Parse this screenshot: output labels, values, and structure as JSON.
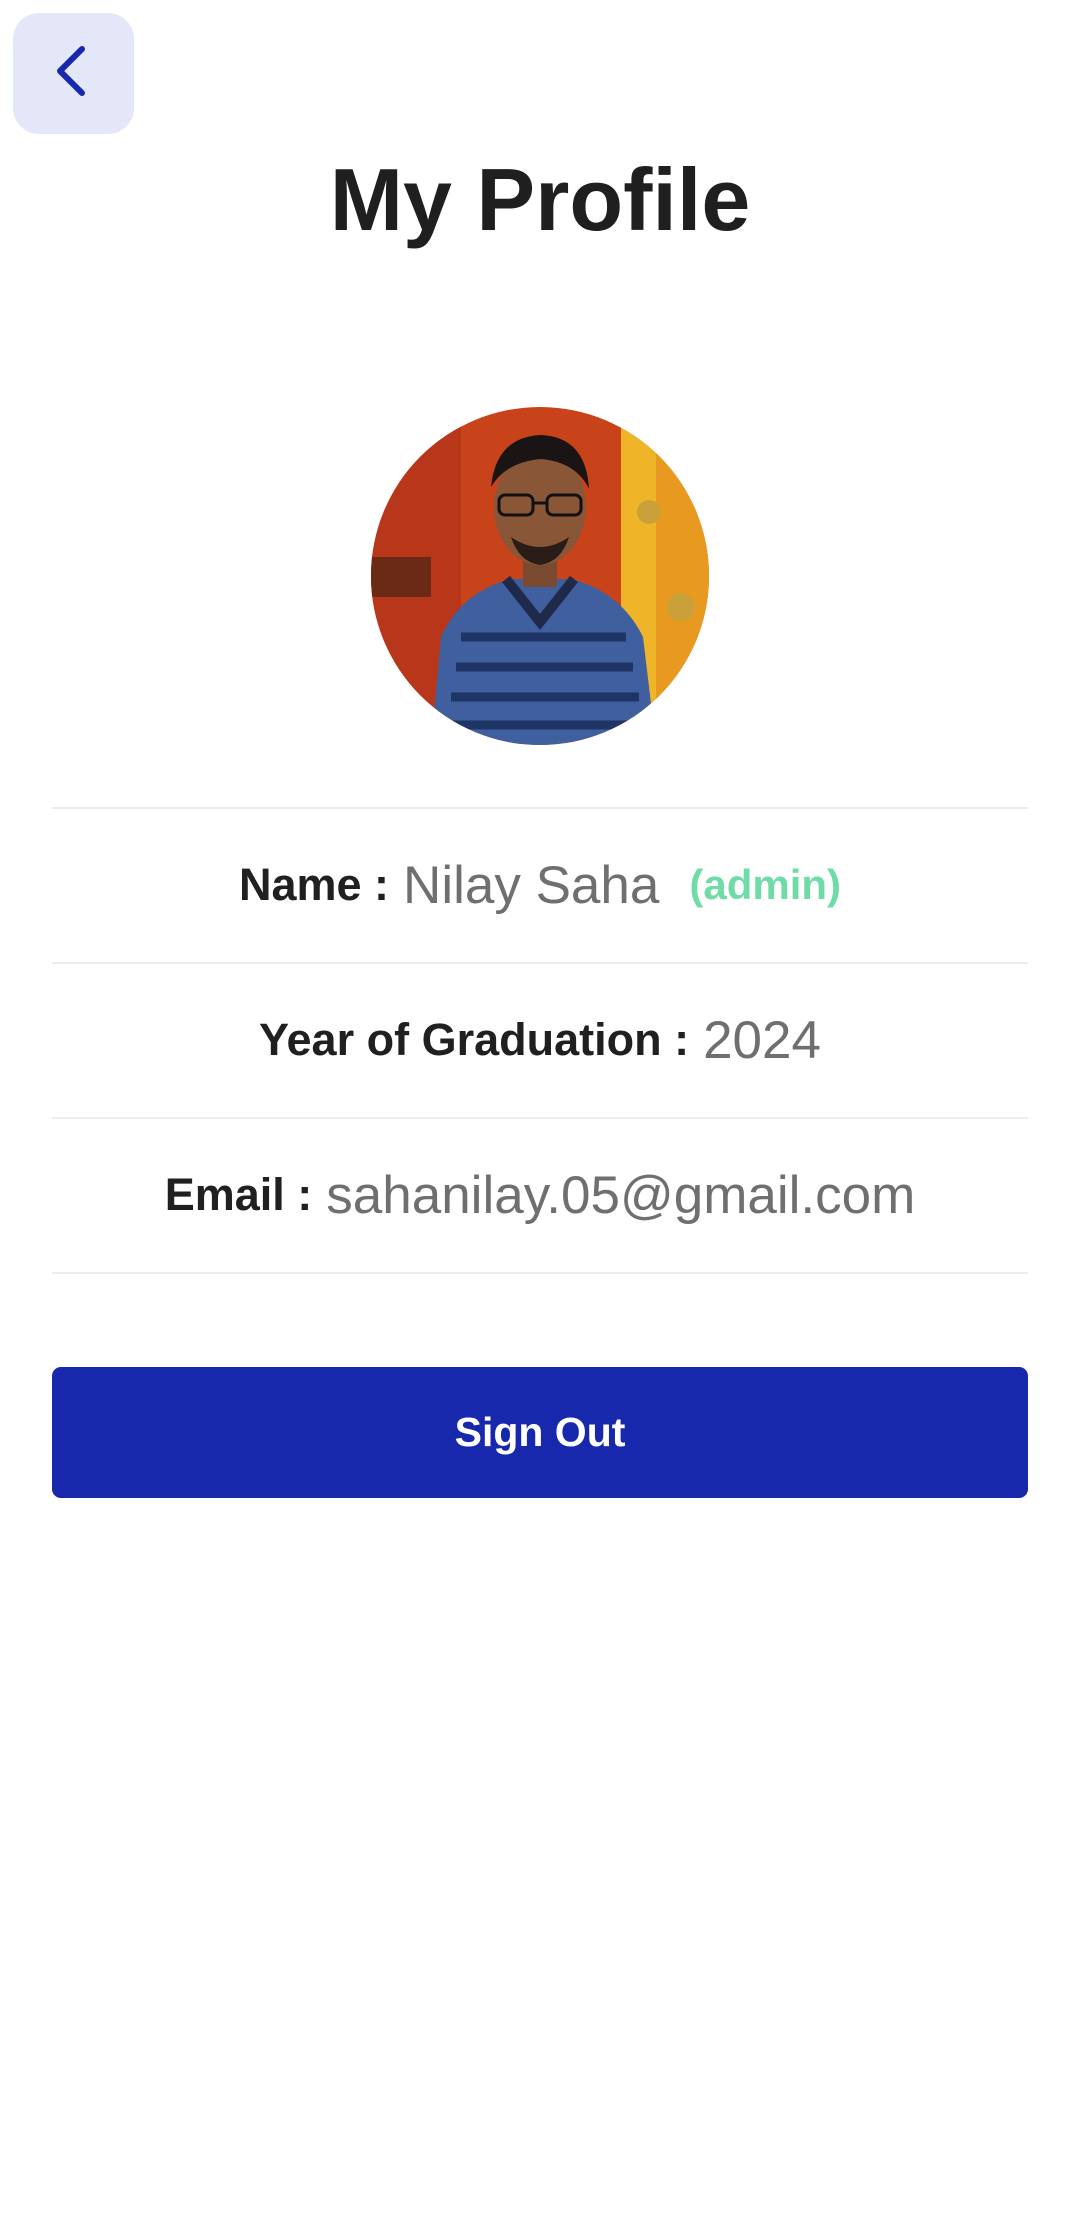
{
  "header": {
    "back_icon": "chevron-left-icon",
    "title": "My Profile"
  },
  "profile": {
    "avatar_icon": "profile-photo",
    "name_label": "Name :",
    "name_value": "Nilay Saha",
    "role_badge": "(admin)",
    "year_label": "Year of Graduation :",
    "year_value": "2024",
    "email_label": "Email :",
    "email_value": "sahanilay.05@gmail.com"
  },
  "actions": {
    "sign_out_label": "Sign Out"
  },
  "colors": {
    "accent": "#1828AD",
    "back_button_bg": "#E3E7F8",
    "admin_badge": "#6FDCA7",
    "value_text": "#6F6F6F",
    "label_text": "#202020"
  }
}
